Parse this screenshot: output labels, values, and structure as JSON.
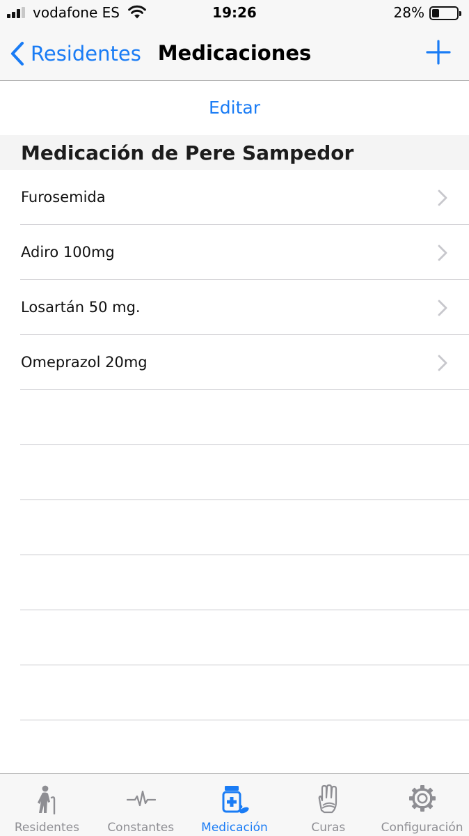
{
  "colors": {
    "accent": "#1a7cf5",
    "inactive": "#8e8e93",
    "chevron": "#c7c7cc",
    "separator": "#c8c7cc",
    "bar_background": "#f7f7f7"
  },
  "status_bar": {
    "carrier": "vodafone ES",
    "signal_bars_filled": 3,
    "signal_bars_total": 4,
    "wifi_icon": "wifi-icon",
    "time": "19:26",
    "battery_percent": "28%",
    "battery_level": 0.28
  },
  "nav": {
    "back_label": "Residentes",
    "back_icon": "chevron-left-icon",
    "title": "Medicaciones",
    "add_icon": "plus-icon"
  },
  "edit_label": "Editar",
  "section": {
    "title": "Medicación de Pere Sampedor"
  },
  "medications": [
    {
      "name": "Furosemida"
    },
    {
      "name": "Adiro 100mg"
    },
    {
      "name": "Losartán 50 mg."
    },
    {
      "name": "Omeprazol 20mg"
    }
  ],
  "row_icon": "chevron-right-icon",
  "tabs": [
    {
      "label": "Residentes",
      "icon": "elderly-person-icon",
      "active": false
    },
    {
      "label": "Constantes",
      "icon": "heartbeat-icon",
      "active": false
    },
    {
      "label": "Medicación",
      "icon": "medicine-bottle-icon",
      "active": true
    },
    {
      "label": "Curas",
      "icon": "bandaged-hand-icon",
      "active": false
    },
    {
      "label": "Configuración",
      "icon": "gear-icon",
      "active": false
    }
  ]
}
